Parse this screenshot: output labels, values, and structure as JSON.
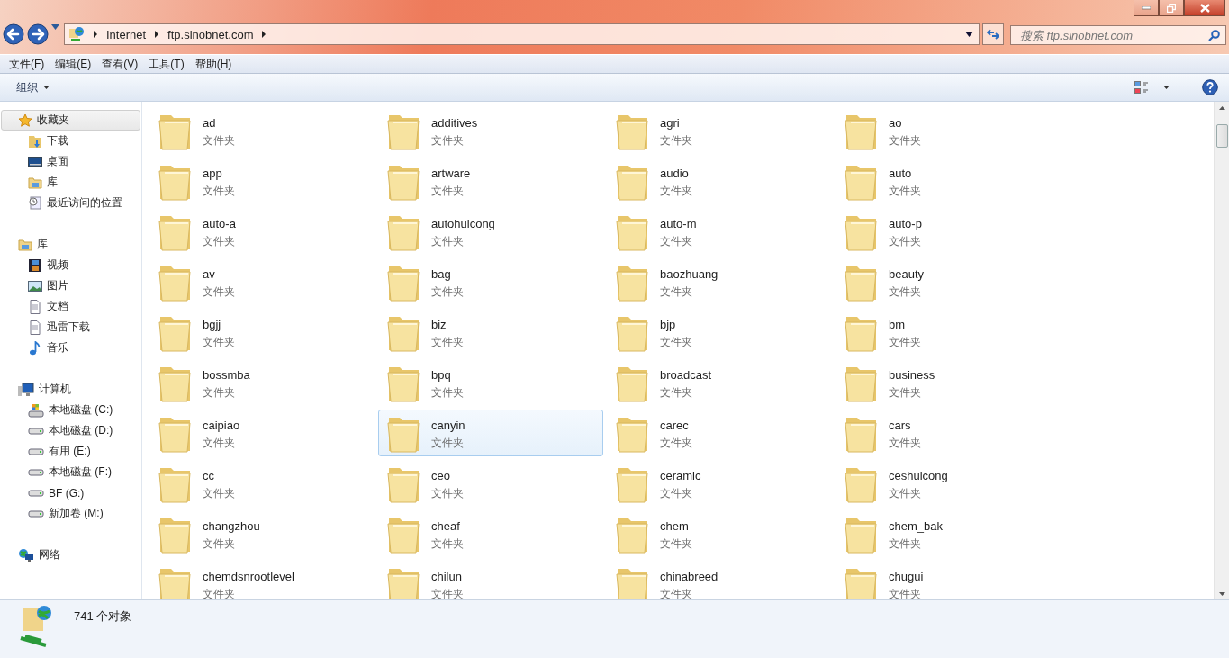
{
  "address_bar": {
    "crumbs": [
      "Internet",
      "ftp.sinobnet.com"
    ]
  },
  "search": {
    "placeholder": "搜索 ftp.sinobnet.com"
  },
  "menu_bar": [
    "文件(F)",
    "编辑(E)",
    "查看(V)",
    "工具(T)",
    "帮助(H)"
  ],
  "toolbar": {
    "organize": "组织"
  },
  "sidebar": {
    "groups": [
      {
        "label": "收藏夹",
        "kind": "favorites",
        "selected": true,
        "children": [
          {
            "label": "下载",
            "kind": "download"
          },
          {
            "label": "桌面",
            "kind": "desktop"
          },
          {
            "label": "库",
            "kind": "library"
          },
          {
            "label": "最近访问的位置",
            "kind": "recent"
          }
        ]
      },
      {
        "label": "库",
        "kind": "library",
        "selected": false,
        "children": [
          {
            "label": "视频",
            "kind": "video"
          },
          {
            "label": "图片",
            "kind": "picture"
          },
          {
            "label": "文档",
            "kind": "document"
          },
          {
            "label": "迅雷下载",
            "kind": "document"
          },
          {
            "label": "音乐",
            "kind": "music"
          }
        ]
      },
      {
        "label": "计算机",
        "kind": "computer",
        "selected": false,
        "children": [
          {
            "label": "本地磁盘 (C:)",
            "kind": "system-drive"
          },
          {
            "label": "本地磁盘 (D:)",
            "kind": "drive"
          },
          {
            "label": "有用 (E:)",
            "kind": "drive"
          },
          {
            "label": "本地磁盘 (F:)",
            "kind": "drive"
          },
          {
            "label": "BF (G:)",
            "kind": "drive"
          },
          {
            "label": "新加卷 (M:)",
            "kind": "drive"
          }
        ]
      },
      {
        "label": "网络",
        "kind": "network",
        "selected": false
      }
    ]
  },
  "folders": [
    {
      "name": "ad",
      "type": "文件夹",
      "selected": false
    },
    {
      "name": "additives",
      "type": "文件夹",
      "selected": false
    },
    {
      "name": "agri",
      "type": "文件夹",
      "selected": false
    },
    {
      "name": "ao",
      "type": "文件夹",
      "selected": false
    },
    {
      "name": "app",
      "type": "文件夹",
      "selected": false
    },
    {
      "name": "artware",
      "type": "文件夹",
      "selected": false
    },
    {
      "name": "audio",
      "type": "文件夹",
      "selected": false
    },
    {
      "name": "auto",
      "type": "文件夹",
      "selected": false
    },
    {
      "name": "auto-a",
      "type": "文件夹",
      "selected": false
    },
    {
      "name": "autohuicong",
      "type": "文件夹",
      "selected": false
    },
    {
      "name": "auto-m",
      "type": "文件夹",
      "selected": false
    },
    {
      "name": "auto-p",
      "type": "文件夹",
      "selected": false
    },
    {
      "name": "av",
      "type": "文件夹",
      "selected": false
    },
    {
      "name": "bag",
      "type": "文件夹",
      "selected": false
    },
    {
      "name": "baozhuang",
      "type": "文件夹",
      "selected": false
    },
    {
      "name": "beauty",
      "type": "文件夹",
      "selected": false
    },
    {
      "name": "bgjj",
      "type": "文件夹",
      "selected": false
    },
    {
      "name": "biz",
      "type": "文件夹",
      "selected": false
    },
    {
      "name": "bjp",
      "type": "文件夹",
      "selected": false
    },
    {
      "name": "bm",
      "type": "文件夹",
      "selected": false
    },
    {
      "name": "bossmba",
      "type": "文件夹",
      "selected": false
    },
    {
      "name": "bpq",
      "type": "文件夹",
      "selected": false
    },
    {
      "name": "broadcast",
      "type": "文件夹",
      "selected": false
    },
    {
      "name": "business",
      "type": "文件夹",
      "selected": false
    },
    {
      "name": "caipiao",
      "type": "文件夹",
      "selected": false
    },
    {
      "name": "canyin",
      "type": "文件夹",
      "selected": true
    },
    {
      "name": "carec",
      "type": "文件夹",
      "selected": false
    },
    {
      "name": "cars",
      "type": "文件夹",
      "selected": false
    },
    {
      "name": "cc",
      "type": "文件夹",
      "selected": false
    },
    {
      "name": "ceo",
      "type": "文件夹",
      "selected": false
    },
    {
      "name": "ceramic",
      "type": "文件夹",
      "selected": false
    },
    {
      "name": "ceshuicong",
      "type": "文件夹",
      "selected": false
    },
    {
      "name": "changzhou",
      "type": "文件夹",
      "selected": false
    },
    {
      "name": "cheaf",
      "type": "文件夹",
      "selected": false
    },
    {
      "name": "chem",
      "type": "文件夹",
      "selected": false
    },
    {
      "name": "chem_bak",
      "type": "文件夹",
      "selected": false
    },
    {
      "name": "chemdsnrootlevel",
      "type": "文件夹",
      "selected": false
    },
    {
      "name": "chilun",
      "type": "文件夹",
      "selected": false
    },
    {
      "name": "chinabreed",
      "type": "文件夹",
      "selected": false
    },
    {
      "name": "chugui",
      "type": "文件夹",
      "selected": false
    }
  ],
  "status_bar": {
    "count": "741 个对象"
  }
}
